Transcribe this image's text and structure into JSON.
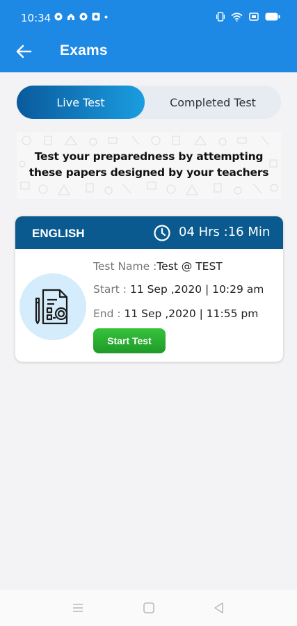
{
  "status_bar": {
    "time": "10:34"
  },
  "app_bar": {
    "title": "Exams"
  },
  "tabs": {
    "live": "Live Test",
    "completed": "Completed Test",
    "active": "live"
  },
  "banner": {
    "line1": "Test your preparedness by attempting",
    "line2": "these papers designed by your teachers"
  },
  "exam_card": {
    "subject": "ENGLISH",
    "time_remaining": "04 Hrs :16 Min",
    "test_name_label": "Test Name :",
    "test_name": "Test @ TEST",
    "start_label": "Start :",
    "start": " 11 Sep ,2020 | 10:29 am",
    "end_label": "End :",
    "end": " 11 Sep ,2020 | 11:55 pm",
    "button": "Start Test",
    "icon": "document-icon"
  },
  "colors": {
    "primary": "#1e88e5",
    "card_header": "#0b5a8f",
    "button": "#2aae31"
  }
}
